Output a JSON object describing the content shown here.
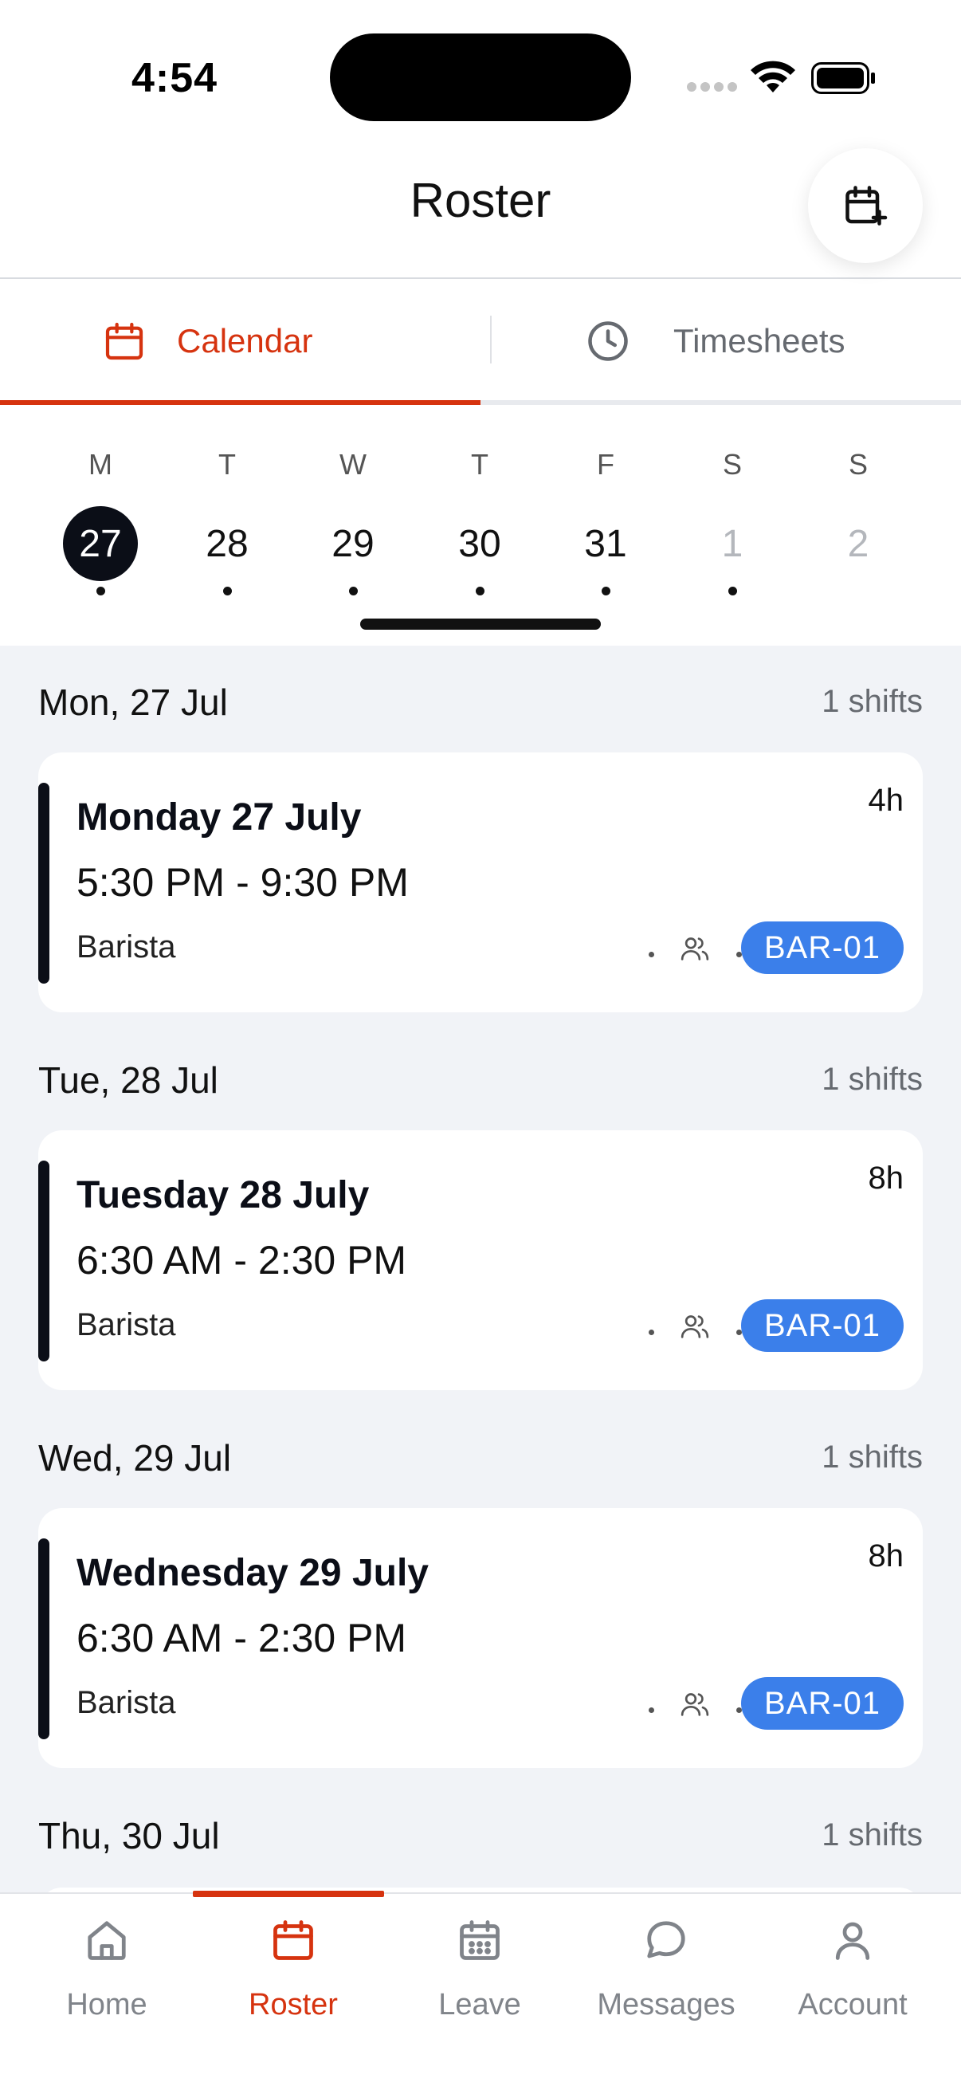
{
  "status_bar": {
    "time": "4:54"
  },
  "header": {
    "title": "Roster",
    "add_calendar_icon": "calendar-plus-icon"
  },
  "tabs": [
    {
      "label": "Calendar",
      "icon": "calendar-icon",
      "active": true
    },
    {
      "label": "Timesheets",
      "icon": "clock-icon",
      "active": false
    }
  ],
  "week": {
    "days": [
      {
        "letter": "M",
        "num": "27",
        "selected": true,
        "has_shift": true,
        "muted": false
      },
      {
        "letter": "T",
        "num": "28",
        "selected": false,
        "has_shift": true,
        "muted": false
      },
      {
        "letter": "W",
        "num": "29",
        "selected": false,
        "has_shift": true,
        "muted": false
      },
      {
        "letter": "T",
        "num": "30",
        "selected": false,
        "has_shift": true,
        "muted": false
      },
      {
        "letter": "F",
        "num": "31",
        "selected": false,
        "has_shift": true,
        "muted": false
      },
      {
        "letter": "S",
        "num": "1",
        "selected": false,
        "has_shift": true,
        "muted": true
      },
      {
        "letter": "S",
        "num": "2",
        "selected": false,
        "has_shift": false,
        "muted": true
      }
    ]
  },
  "schedule": [
    {
      "date_label": "Mon, 27 Jul",
      "count_label": "1 shifts",
      "shift": {
        "title": "Monday 27 July",
        "time": "5:30 PM - 9:30 PM",
        "role": "Barista",
        "duration": "4h",
        "badge": "BAR-01"
      }
    },
    {
      "date_label": "Tue, 28 Jul",
      "count_label": "1 shifts",
      "shift": {
        "title": "Tuesday 28 July",
        "time": "6:30 AM - 2:30 PM",
        "role": "Barista",
        "duration": "8h",
        "badge": "BAR-01"
      }
    },
    {
      "date_label": "Wed, 29 Jul",
      "count_label": "1 shifts",
      "shift": {
        "title": "Wednesday 29 July",
        "time": "6:30 AM - 2:30 PM",
        "role": "Barista",
        "duration": "8h",
        "badge": "BAR-01"
      }
    },
    {
      "date_label": "Thu, 30 Jul",
      "count_label": "1 shifts"
    }
  ],
  "nav": [
    {
      "label": "Home",
      "icon": "home-icon",
      "active": false
    },
    {
      "label": "Roster",
      "icon": "calendar-icon",
      "active": true
    },
    {
      "label": "Leave",
      "icon": "calendar-grid-icon",
      "active": false
    },
    {
      "label": "Messages",
      "icon": "chat-bubble-icon",
      "active": false
    },
    {
      "label": "Account",
      "icon": "person-icon",
      "active": false
    }
  ],
  "colors": {
    "accent": "#d6330f",
    "badge": "#3b7fea",
    "dark": "#0b0e17",
    "list_bg": "#f1f3f7"
  }
}
